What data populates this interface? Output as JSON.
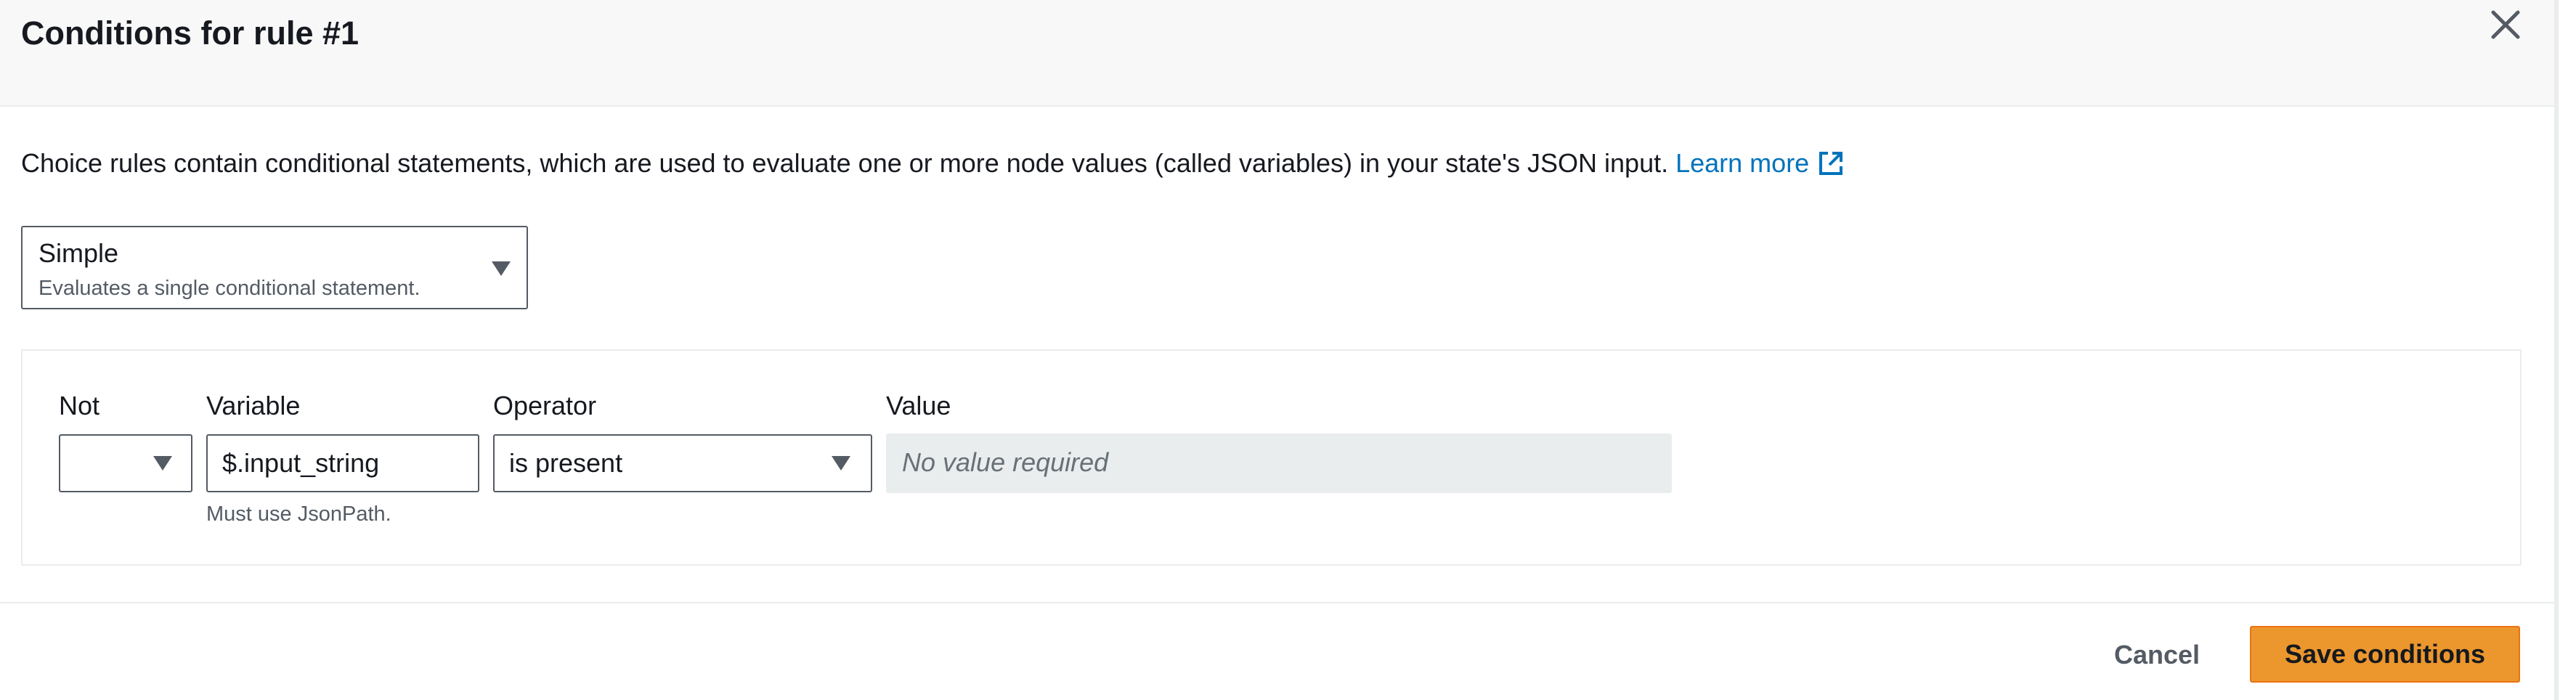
{
  "modal": {
    "title": "Conditions for rule #1",
    "close_icon": "close-icon"
  },
  "description": {
    "text": "Choice rules contain conditional statements, which are used to evaluate one or more node values (called variables) in your state's JSON input.",
    "learn_more": "Learn more",
    "learn_more_icon": "external-link-icon"
  },
  "rule_type": {
    "selected": "Simple",
    "description": "Evaluates a single conditional statement.",
    "icon": "caret-down-icon"
  },
  "condition": {
    "not_label": "Not",
    "not_value": "",
    "variable_label": "Variable",
    "variable_value": "$.input_string",
    "variable_hint": "Must use JsonPath.",
    "operator_label": "Operator",
    "operator_value": "is present",
    "value_label": "Value",
    "value_placeholder": "No value required"
  },
  "footer": {
    "cancel_label": "Cancel",
    "save_label": "Save conditions"
  },
  "colors": {
    "primary_button": "#ec972d",
    "link": "#0073bb",
    "header_background": "#f8f8f8",
    "disabled_field": "#eaeded"
  }
}
